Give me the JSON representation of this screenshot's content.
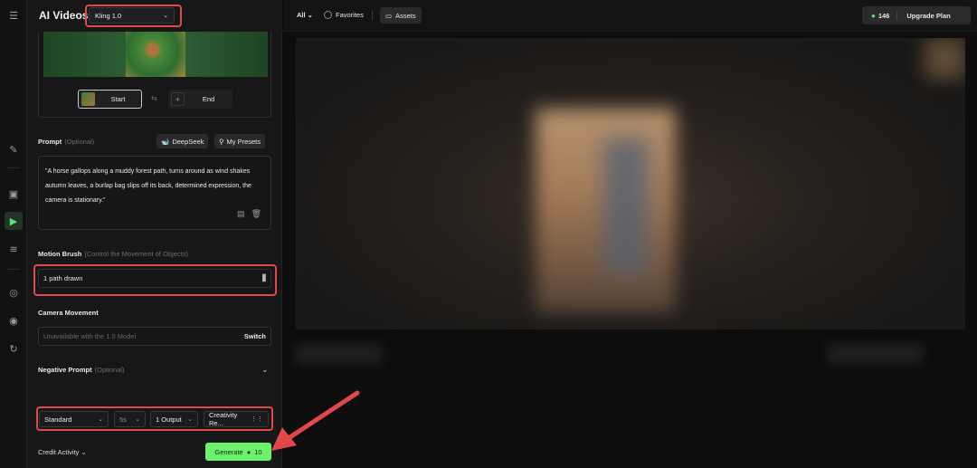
{
  "app": {
    "title": "AI Videos",
    "model": "Kling 1.0"
  },
  "frames": {
    "start_label": "Start",
    "end_label": "End"
  },
  "prompt": {
    "label": "Prompt",
    "optional": "(Optional)",
    "deepseek_label": "DeepSeek",
    "presets_label": "My Presets",
    "text": "\"A horse gallops along a muddy forest path, turns around as wind shakes autumn leaves, a burlap bag slips off its back, determined expression, the camera is stationary.\""
  },
  "motion_brush": {
    "label": "Motion Brush",
    "hint": "(Control the Movement of Objects)",
    "value": "1 path drawn"
  },
  "camera": {
    "label": "Camera Movement",
    "placeholder": "Unavailable with the 1.0 Model",
    "switch_label": "Switch"
  },
  "negative_prompt": {
    "label": "Negative Prompt",
    "optional": "(Optional)"
  },
  "options": {
    "mode": "Standard",
    "duration": "5s",
    "outputs": "1 Output",
    "creativity": "Creativity Re..."
  },
  "footer": {
    "credit_activity": "Credit Activity",
    "generate_label": "Generate",
    "generate_cost": "10"
  },
  "main": {
    "filter_all": "All",
    "favorites": "Favorites",
    "assets": "Assets",
    "credits": "146",
    "upgrade": "Upgrade Plan"
  },
  "colors": {
    "accent_green": "#6bf26d",
    "highlight_red": "#e2474a"
  }
}
